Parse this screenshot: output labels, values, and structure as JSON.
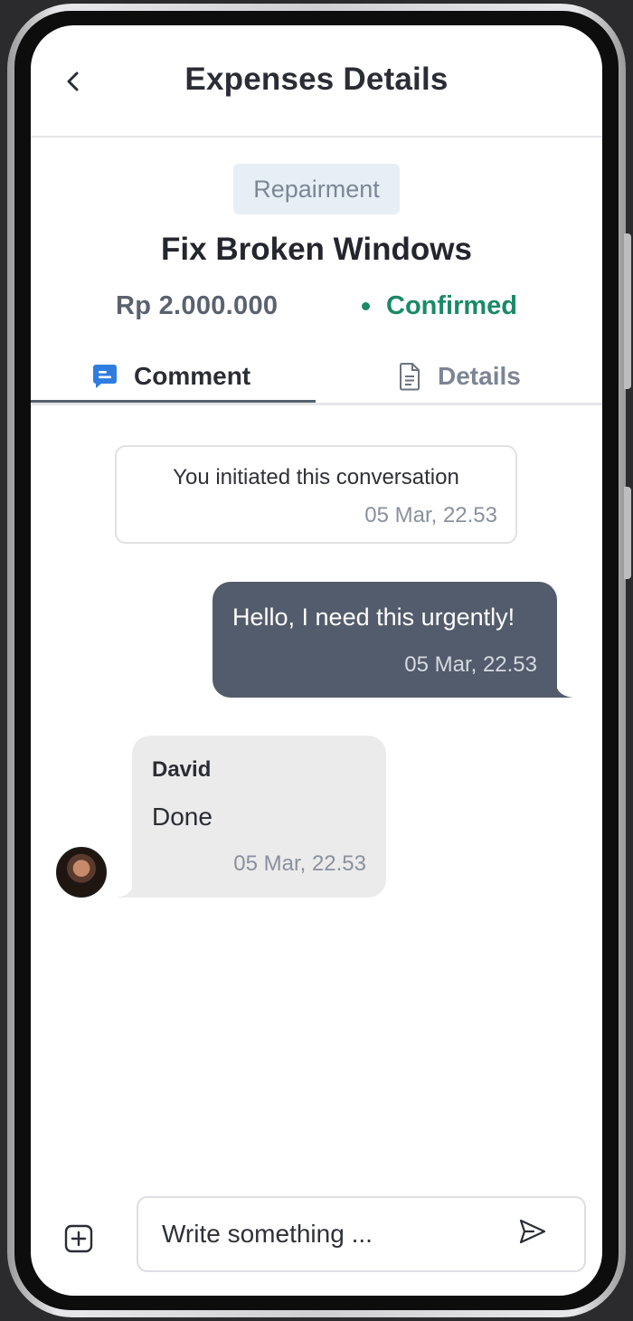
{
  "header": {
    "title": "Expenses Details",
    "back_icon": "chevron-left-icon"
  },
  "expense": {
    "category": "Repairment",
    "title": "Fix Broken Windows",
    "amount": "Rp 2.000.000",
    "status": "Confirmed",
    "status_color": "#1a8a66"
  },
  "tabs": [
    {
      "label": "Comment",
      "icon": "chat-icon",
      "active": true
    },
    {
      "label": "Details",
      "icon": "document-icon",
      "active": false
    }
  ],
  "conversation": {
    "system_message": {
      "text": "You initiated this conversation",
      "time": "05 Mar, 22.53"
    },
    "messages": [
      {
        "direction": "outgoing",
        "text": "Hello, I need this urgently!",
        "time": "05 Mar, 22.53"
      },
      {
        "direction": "incoming",
        "sender": "David",
        "text": "Done",
        "time": "05 Mar, 22.53"
      }
    ]
  },
  "composer": {
    "placeholder": "Write something ...",
    "attach_icon": "plus-square-icon",
    "send_icon": "send-icon"
  },
  "colors": {
    "accent_blue": "#2f7de1",
    "outgoing_bubble": "#535c6c",
    "incoming_bubble": "#ebebec"
  }
}
